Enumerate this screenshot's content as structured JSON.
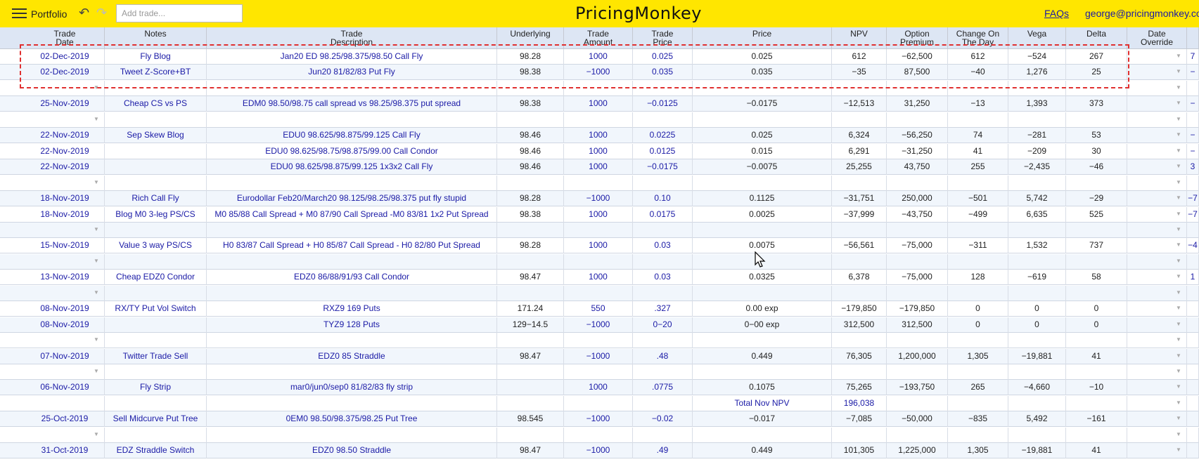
{
  "app": {
    "menu_label": "Portfolio",
    "add_trade_placeholder": "Add trade...",
    "brand": "PricingMonkey",
    "faqs": "FAQs",
    "user": "george@pricingmonkey.com"
  },
  "columns": [
    {
      "label": "Trade\nDate"
    },
    {
      "label": "Notes"
    },
    {
      "label": "Trade\nDescription"
    },
    {
      "label": "Underlying"
    },
    {
      "label": "Trade\nAmount"
    },
    {
      "label": "Trade\nPrice"
    },
    {
      "label": "Price"
    },
    {
      "label": "NPV"
    },
    {
      "label": "Option\nPremium"
    },
    {
      "label": "Change On\nThe Day"
    },
    {
      "label": "Vega"
    },
    {
      "label": "Delta"
    },
    {
      "label": "Date\nOverride"
    },
    {
      "label": ""
    }
  ],
  "rows": [
    {
      "c": [
        "02-Dec-2019",
        "Fly Blog",
        "Jan20 ED 98.25/98.375/98.50 Call Fly",
        "98.28",
        "1000",
        "0.025",
        "0.025",
        "612",
        "−62,500",
        "612",
        "−524",
        "267",
        "",
        "7"
      ],
      "drop": true
    },
    {
      "c": [
        "02-Dec-2019",
        "Tweet Z-Score+BT",
        "Jun20 81/82/83 Put Fly",
        "98.38",
        "−1000",
        "0.035",
        "0.035",
        "−35",
        "87,500",
        "−40",
        "1,276",
        "25",
        "",
        "−"
      ],
      "drop": true
    },
    {
      "c": [
        "",
        "",
        "",
        "",
        "",
        "",
        "",
        "",
        "",
        "",
        "",
        "",
        "",
        ""
      ],
      "drop": true
    },
    {
      "c": [
        "25-Nov-2019",
        "Cheap CS vs PS",
        "EDM0 98.50/98.75 call spread vs 98.25/98.375 put spread",
        "98.38",
        "1000",
        "−0.0125",
        "−0.0175",
        "−12,513",
        "31,250",
        "−13",
        "1,393",
        "373",
        "",
        "−"
      ],
      "drop": true
    },
    {
      "c": [
        "",
        "",
        "",
        "",
        "",
        "",
        "",
        "",
        "",
        "",
        "",
        "",
        "",
        ""
      ],
      "drop": true
    },
    {
      "c": [
        "22-Nov-2019",
        "Sep Skew Blog",
        "EDU0 98.625/98.875/99.125 Call Fly",
        "98.46",
        "1000",
        "0.0225",
        "0.025",
        "6,324",
        "−56,250",
        "74",
        "−281",
        "53",
        "",
        "−"
      ],
      "drop": true
    },
    {
      "c": [
        "22-Nov-2019",
        "",
        "EDU0 98.625/98.75/98.875/99.00 Call Condor",
        "98.46",
        "1000",
        "0.0125",
        "0.015",
        "6,291",
        "−31,250",
        "41",
        "−209",
        "30",
        "",
        "−"
      ],
      "drop": true
    },
    {
      "c": [
        "22-Nov-2019",
        "",
        "EDU0 98.625/98.875/99.125 1x3x2 Call Fly",
        "98.46",
        "1000",
        "−0.0175",
        "−0.0075",
        "25,255",
        "43,750",
        "255",
        "−2,435",
        "−46",
        "",
        "3"
      ],
      "drop": true
    },
    {
      "c": [
        "",
        "",
        "",
        "",
        "",
        "",
        "",
        "",
        "",
        "",
        "",
        "",
        "",
        ""
      ],
      "drop": true
    },
    {
      "c": [
        "18-Nov-2019",
        "Rich Call Fly",
        "Eurodollar Feb20/March20 98.125/98.25/98.375 put fly stupid",
        "98.28",
        "−1000",
        "0.10",
        "0.1125",
        "−31,751",
        "250,000",
        "−501",
        "5,742",
        "−29",
        "",
        "−7"
      ],
      "drop": true
    },
    {
      "c": [
        "18-Nov-2019",
        "Blog M0 3-leg PS/CS",
        "M0 85/88 Call Spread + M0 87/90 Call Spread -M0 83/81 1x2 Put Spread",
        "98.38",
        "1000",
        "0.0175",
        "0.0025",
        "−37,999",
        "−43,750",
        "−499",
        "6,635",
        "525",
        "",
        "−7"
      ],
      "drop": true
    },
    {
      "c": [
        "",
        "",
        "",
        "",
        "",
        "",
        "",
        "",
        "",
        "",
        "",
        "",
        "",
        ""
      ],
      "drop": true
    },
    {
      "c": [
        "15-Nov-2019",
        "Value 3 way PS/CS",
        "H0 83/87 Call Spread + H0 85/87 Call Spread - H0 82/80 Put Spread",
        "98.28",
        "1000",
        "0.03",
        "0.0075",
        "−56,561",
        "−75,000",
        "−311",
        "1,532",
        "737",
        "",
        "−4"
      ],
      "drop": true
    },
    {
      "c": [
        "",
        "",
        "",
        "",
        "",
        "",
        "",
        "",
        "",
        "",
        "",
        "",
        "",
        ""
      ],
      "drop": true
    },
    {
      "c": [
        "13-Nov-2019",
        "Cheap EDZ0 Condor",
        "EDZ0 86/88/91/93 Call Condor",
        "98.47",
        "1000",
        "0.03",
        "0.0325",
        "6,378",
        "−75,000",
        "128",
        "−619",
        "58",
        "",
        "1"
      ],
      "drop": true
    },
    {
      "c": [
        "",
        "",
        "",
        "",
        "",
        "",
        "",
        "",
        "",
        "",
        "",
        "",
        "",
        ""
      ],
      "drop": true
    },
    {
      "c": [
        "08-Nov-2019",
        "RX/TY Put Vol Switch",
        "RXZ9 169 Puts",
        "171.24",
        "550",
        ".327",
        "0.00 exp",
        "−179,850",
        "−179,850",
        "0",
        "0",
        "0",
        "",
        ""
      ],
      "drop": true
    },
    {
      "c": [
        "08-Nov-2019",
        "",
        "TYZ9 128 Puts",
        "129−14.5",
        "−1000",
        "0−20",
        "0−00 exp",
        "312,500",
        "312,500",
        "0",
        "0",
        "0",
        "",
        ""
      ],
      "drop": true
    },
    {
      "c": [
        "",
        "",
        "",
        "",
        "",
        "",
        "",
        "",
        "",
        "",
        "",
        "",
        "",
        ""
      ],
      "drop": true
    },
    {
      "c": [
        "07-Nov-2019",
        "Twitter Trade Sell",
        "EDZ0 85 Straddle",
        "98.47",
        "−1000",
        ".48",
        "0.449",
        "76,305",
        "1,200,000",
        "1,305",
        "−19,881",
        "41",
        "",
        ""
      ],
      "drop": true
    },
    {
      "c": [
        "",
        "",
        "",
        "",
        "",
        "",
        "",
        "",
        "",
        "",
        "",
        "",
        "",
        ""
      ],
      "drop": true
    },
    {
      "c": [
        "06-Nov-2019",
        "Fly Strip",
        "mar0/jun0/sep0 81/82/83 fly strip",
        "",
        "1000",
        ".0775",
        "0.1075",
        "75,265",
        "−193,750",
        "265",
        "−4,660",
        "−10",
        "",
        ""
      ],
      "drop": true
    },
    {
      "c": [
        "",
        "",
        "",
        "",
        "",
        "",
        "Total Nov NPV",
        "196,038",
        "",
        "",
        "",
        "",
        "",
        ""
      ],
      "drop": true
    },
    {
      "c": [
        "25-Oct-2019",
        "Sell Midcurve Put Tree",
        "0EM0 98.50/98.375/98.25 Put Tree",
        "98.545",
        "−1000",
        "−0.02",
        "−0.017",
        "−7,085",
        "−50,000",
        "−835",
        "5,492",
        "−161",
        "",
        ""
      ],
      "drop": true
    },
    {
      "c": [
        "",
        "",
        "",
        "",
        "",
        "",
        "",
        "",
        "",
        "",
        "",
        "",
        "",
        ""
      ],
      "drop": true
    },
    {
      "c": [
        "31-Oct-2019",
        "EDZ Straddle Switch",
        "EDZ0 98.50 Straddle",
        "98.47",
        "−1000",
        ".49",
        "0.449",
        "101,305",
        "1,225,000",
        "1,305",
        "−19,881",
        "41",
        "",
        ""
      ],
      "drop": true
    }
  ]
}
